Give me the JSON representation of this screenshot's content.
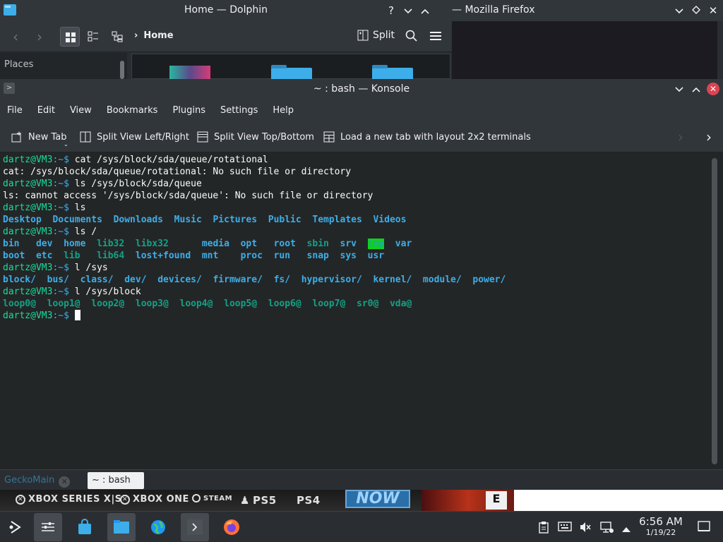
{
  "dolphin": {
    "title": "Home — Dolphin",
    "breadcrumb": "Home",
    "split_label": "Split",
    "places_label": "Places"
  },
  "firefox": {
    "title": "— Mozilla Firefox"
  },
  "konsole": {
    "title": "~ : bash — Konsole",
    "menu": [
      "File",
      "Edit",
      "View",
      "Bookmarks",
      "Plugins",
      "Settings",
      "Help"
    ],
    "toolbar": {
      "new_tab": "New Tab",
      "split_lr": "Split View Left/Right",
      "split_tb": "Split View Top/Bottom",
      "layout_2x2": "Load a new tab with layout 2x2 terminals"
    },
    "prompt_user": "dartz@VM3",
    "prompt_path": ":~$",
    "terminal": {
      "cmd1": " cat /sys/block/sda/queue/rotational",
      "out1": "cat: /sys/block/sda/queue/rotational: No such file or directory",
      "cmd2": " ls /sys/block/sda/queue",
      "out2": "ls: cannot access '/sys/block/sda/queue': No such file or directory",
      "cmd3": " ls",
      "home_dirs": [
        "Desktop",
        "Documents",
        "Downloads",
        "Music",
        "Pictures",
        "Public",
        "Templates",
        "Videos"
      ],
      "cmd4": " ls /",
      "root_row1": [
        "bin",
        "dev",
        "home",
        "lib32",
        "libx32",
        "media",
        "opt",
        "root",
        "sbin",
        "srv",
        "tmp",
        "var"
      ],
      "root_row2": [
        "boot",
        "etc",
        "lib",
        "lib64",
        "lost+found",
        "mnt",
        "proc",
        "run",
        "snap",
        "sys",
        "usr"
      ],
      "cmd5": " l /sys",
      "sys_dirs": [
        "block/",
        "bus/",
        "class/",
        "dev/",
        "devices/",
        "firmware/",
        "fs/",
        "hypervisor/",
        "kernel/",
        "module/",
        "power/"
      ],
      "cmd6": " l /sys/block",
      "block_links": [
        "loop0@",
        "loop1@",
        "loop2@",
        "loop3@",
        "loop4@",
        "loop5@",
        "loop6@",
        "loop7@",
        "sr0@",
        "vda@"
      ]
    },
    "tabs": [
      {
        "label": "GeckoMain"
      },
      {
        "label": "~ : bash"
      }
    ]
  },
  "banner": {
    "xbox_series": "XBOX SERIES X|S",
    "xbox_one": "XBOX ONE",
    "steam": "STEAM",
    "ps5": "PS5",
    "ps4": "PS4",
    "now": "NOW",
    "esrb": "E"
  },
  "taskbar": {
    "time": "6:56 AM",
    "date": "1/19/22"
  },
  "colors": {
    "prompt_user": "#1cdc9a",
    "prompt_path": "#3daee9",
    "accent": "#3daee9",
    "close": "#da4453",
    "tmp_bg": "#11d116"
  }
}
